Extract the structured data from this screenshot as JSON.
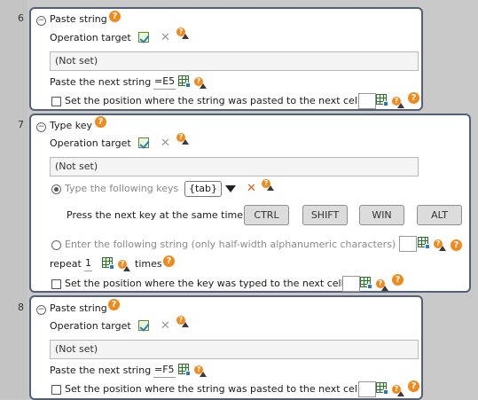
{
  "steps": [
    {
      "number": "6",
      "title": "Paste string",
      "operation_target_label": "Operation target",
      "target_value": "(Not set)",
      "paste_label": "Paste the next string",
      "paste_value": "=E5",
      "checkbox_label": "Set the position where the string was pasted to the next cell"
    },
    {
      "number": "7",
      "title": "Type key",
      "operation_target_label": "Operation target",
      "target_value": "(Not set)",
      "type_keys_label": "Type the following keys",
      "keys_value": "{tab}",
      "press_same_time_label": "Press the next key at the same time",
      "modifier_keys": [
        "CTRL",
        "SHIFT",
        "WIN",
        "ALT"
      ],
      "enter_string_label": "Enter the following string (only half-width alphanumeric characters)",
      "repeat_label": "repeat",
      "repeat_value": "1",
      "times_label": "times",
      "checkbox_label": "Set the position where the key was typed to the next cell"
    },
    {
      "number": "8",
      "title": "Paste string",
      "operation_target_label": "Operation target",
      "target_value": "(Not set)",
      "paste_label": "Paste the next string",
      "paste_value": "=F5",
      "checkbox_label": "Set the position where the string was pasted to the next cell"
    }
  ],
  "icons": {
    "help": "question-icon",
    "edit": "edit-target-icon",
    "clear": "clear-x-icon",
    "cell": "cell-picker-icon"
  },
  "colors": {
    "card_border": "#54607a",
    "help_orange": "#f08a1c",
    "background": "#c9c9c9"
  }
}
